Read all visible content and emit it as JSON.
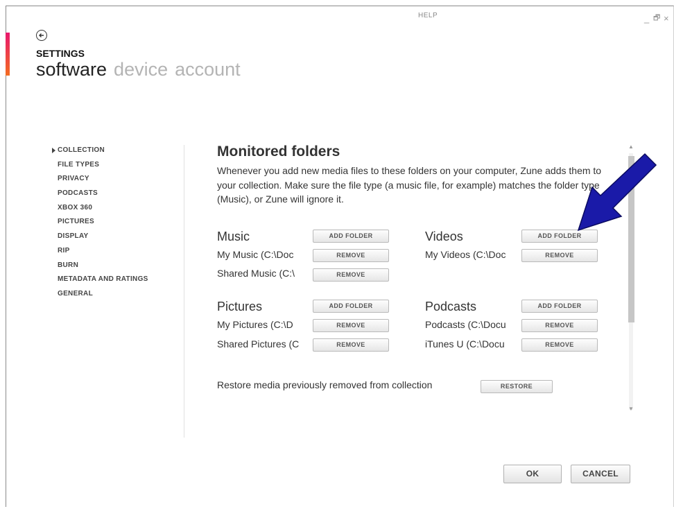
{
  "window": {
    "help_label": "HELP",
    "minimize": "_",
    "restore": "🗗",
    "close": "×"
  },
  "header": {
    "title": "SETTINGS",
    "tabs": [
      "software",
      "device",
      "account"
    ]
  },
  "sidebar": {
    "items": [
      {
        "label": "COLLECTION",
        "selected": true
      },
      {
        "label": "FILE TYPES"
      },
      {
        "label": "PRIVACY"
      },
      {
        "label": "PODCASTS"
      },
      {
        "label": "XBOX 360"
      },
      {
        "label": "PICTURES"
      },
      {
        "label": "DISPLAY"
      },
      {
        "label": "RIP"
      },
      {
        "label": "BURN"
      },
      {
        "label": "METADATA AND RATINGS"
      },
      {
        "label": "GENERAL"
      }
    ]
  },
  "main": {
    "heading": "Monitored folders",
    "description": "Whenever you add new media files to these folders on your computer, Zune adds them to your collection. Make sure the file type (a music file, for example) matches the folder type (Music), or Zune will ignore it.",
    "add_folder_label": "ADD FOLDER",
    "remove_label": "REMOVE",
    "categories": {
      "music": {
        "title": "Music",
        "folders": [
          "My Music (C:\\Doc",
          "Shared Music (C:\\"
        ]
      },
      "videos": {
        "title": "Videos",
        "folders": [
          "My Videos (C:\\Doc"
        ]
      },
      "pictures": {
        "title": "Pictures",
        "folders": [
          "My Pictures (C:\\D",
          "Shared Pictures (C"
        ]
      },
      "podcasts": {
        "title": "Podcasts",
        "folders": [
          "Podcasts (C:\\Docu",
          "iTunes U (C:\\Docu"
        ]
      }
    },
    "restore_text": "Restore media previously removed from collection",
    "restore_label": "RESTORE"
  },
  "footer": {
    "ok_label": "OK",
    "cancel_label": "CANCEL"
  },
  "colors": {
    "accent_top": "#e8176d",
    "accent_bottom": "#f36c21",
    "annotation_arrow": "#1a1aa8"
  }
}
